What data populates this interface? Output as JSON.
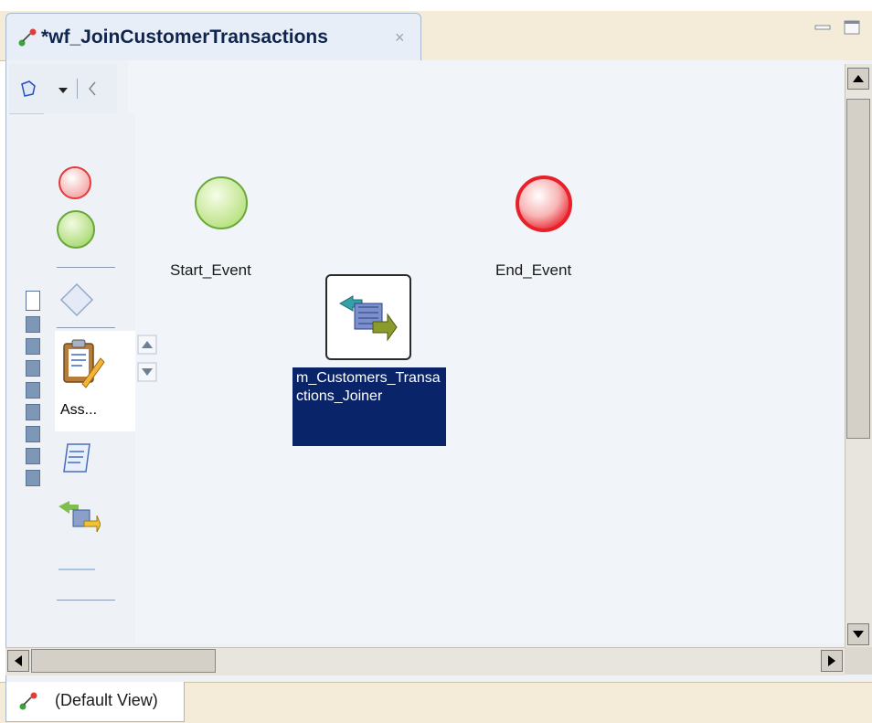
{
  "tab": {
    "title": "*wf_JoinCustomerTransactions",
    "close": "×"
  },
  "palette": {
    "assignment_label": "Ass..."
  },
  "canvas": {
    "start_event_label": "Start_Event",
    "end_event_label": "End_Event",
    "mapping_task_label": "m_Customers_Transactions_Joiner"
  },
  "bottom": {
    "view_label": "(Default View)"
  },
  "icons": {
    "tab": "workflow-icon",
    "palette_header": "select-tool-icon",
    "start": "start-event-icon",
    "end": "end-event-icon",
    "task": "mapping-task-icon"
  },
  "colors": {
    "selection": "#0a246a",
    "start_event": "#b5e07a",
    "end_event": "#e8202a",
    "tab_bar": "#f4ecd9"
  }
}
